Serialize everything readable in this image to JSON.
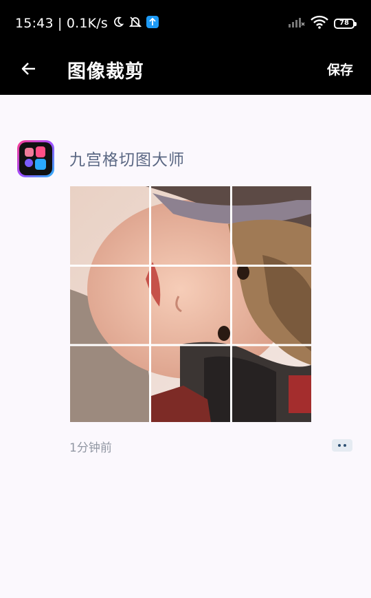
{
  "status_bar": {
    "time_speed": "15:43 | 0.1K/s",
    "battery": "78",
    "icons": [
      "moon-icon",
      "bell-off-icon",
      "upload-app-icon",
      "signal-icon",
      "wifi-icon",
      "battery-icon"
    ]
  },
  "app_bar": {
    "back_icon": "arrow-left-icon",
    "title": "图像裁剪",
    "save_label": "保存"
  },
  "post": {
    "app_name": "九宫格切图大师",
    "app_icon": "grid-app-icon",
    "image_description_icon": "photo-3x3-grid",
    "timestamp": "1分钟前",
    "more_icon": "more-dots-icon"
  },
  "colors": {
    "bar_bg": "#000000",
    "page_bg": "#fbf8fd",
    "app_name": "#5a6783",
    "timestamp": "#9197a3",
    "more_bg": "#e5ebf2"
  }
}
